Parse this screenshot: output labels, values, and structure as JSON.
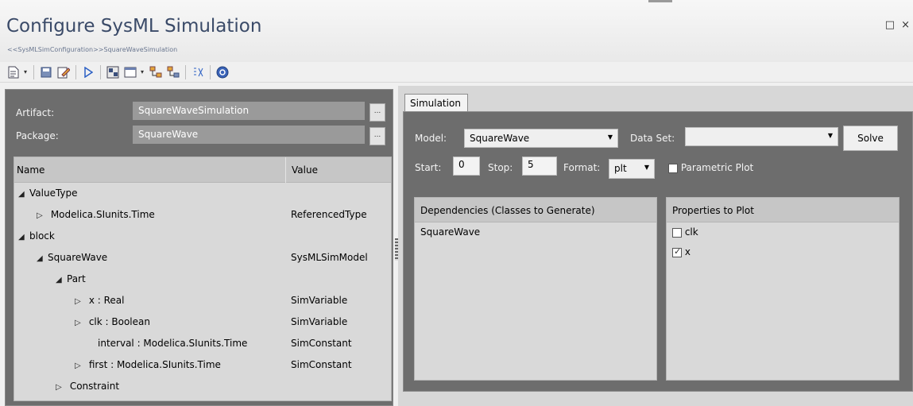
{
  "window": {
    "title": "Configure SysML Simulation",
    "subtitle": "<<SysMLSimConfiguration>>SquareWaveSimulation",
    "maximize_glyph": "□",
    "close_glyph": "×"
  },
  "toolbar": {
    "icons": [
      "new-icon",
      "save-icon",
      "edit-icon",
      "run-icon",
      "generate-code-icon",
      "view-icon",
      "expand-icon",
      "collapse-icon",
      "filter-icon",
      "help-icon"
    ]
  },
  "artifact": {
    "label": "Artifact:",
    "value": "SquareWaveSimulation",
    "button": "..."
  },
  "package": {
    "label": "Package:",
    "value": "SquareWave",
    "button": "..."
  },
  "tree": {
    "columns": {
      "name": "Name",
      "value": "Value"
    },
    "rows": [
      {
        "name": "ValueType",
        "value": "",
        "toggle": "◢"
      },
      {
        "name": "Modelica.SIunits.Time",
        "value": "ReferencedType",
        "toggle": "▷"
      },
      {
        "name": "block",
        "value": "",
        "toggle": "◢"
      },
      {
        "name": "SquareWave",
        "value": "SysMLSimModel",
        "toggle": "◢"
      },
      {
        "name": "Part",
        "value": "",
        "toggle": "◢"
      },
      {
        "name": "x : Real",
        "value": "SimVariable",
        "toggle": "▷"
      },
      {
        "name": "clk : Boolean",
        "value": "SimVariable",
        "toggle": "▷"
      },
      {
        "name": "interval : Modelica.SIunits.Time",
        "value": "SimConstant",
        "toggle": ""
      },
      {
        "name": "first : Modelica.SIunits.Time",
        "value": "SimConstant",
        "toggle": "▷"
      },
      {
        "name": "Constraint",
        "value": "",
        "toggle": "▷"
      }
    ]
  },
  "simulation": {
    "tab_label": "Simulation",
    "model_label": "Model:",
    "model_value": "SquareWave",
    "dataset_label": "Data Set:",
    "dataset_value": "",
    "solve_label": "Solve",
    "start_label": "Start:",
    "start_value": "0",
    "stop_label": "Stop:",
    "stop_value": "5",
    "format_label": "Format:",
    "format_value": "plt",
    "parametric_label": "Parametric Plot",
    "parametric_checked": false,
    "dependencies_header": "Dependencies (Classes to Generate)",
    "dependencies": [
      "SquareWave"
    ],
    "properties_header": "Properties to Plot",
    "properties": [
      {
        "name": "clk",
        "checked": false
      },
      {
        "name": "x",
        "checked": true
      }
    ]
  }
}
